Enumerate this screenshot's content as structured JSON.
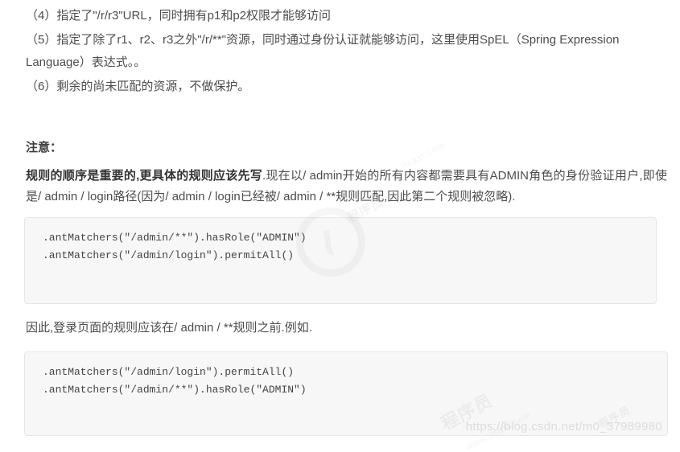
{
  "document": {
    "list_items": [
      {
        "id": "item-4",
        "text": "（4）指定了\"/r/r3\"URL，同时拥有p1和p2权限才能够访问"
      },
      {
        "id": "item-5",
        "text": "（5）指定了除了r1、r2、r3之外\"/r/**\"资源，同时通过身份认证就能够访问，这里使用SpEL（Spring Expression Language）表达式。。"
      },
      {
        "id": "item-6",
        "text": "（6）剩余的尚未匹配的资源，不做保护。"
      }
    ],
    "notice": {
      "title": "注意：",
      "bold_lead": "规则的顺序是重要的,更具体的规则应该先写",
      "rest": ".现在以/ admin开始的所有内容都需要具有ADMIN角色的身份验证用户,即使是/ admin / login路径(因为/ admin / login已经被/ admin / **规则匹配,因此第二个规则被忽略)."
    },
    "middle_text": "因此,登录页面的规则应该在/ admin / **规则之前.例如.",
    "code_blocks": [
      {
        "id": "code-block-1",
        "lines": [
          ".antMatchers(\"/admin/**\").hasRole(\"ADMIN\")",
          ".antMatchers(\"/admin/login\").permitAll()"
        ]
      },
      {
        "id": "code-block-2",
        "lines": [
          ".antMatchers(\"/admin/login\").permitAll()",
          ".antMatchers(\"/admin/**\").hasRole(\"ADMIN\")"
        ]
      }
    ],
    "watermarks": {
      "url": "https://blog.csdn.net/m0_37989980",
      "diagonal_1": "程序员",
      "diagonal_2": "www.itcast.com",
      "diagonal_3": "程序员",
      "diagonal_4": "www.itcast.com",
      "diagonal_5": "程序员"
    }
  },
  "colors": {
    "text": "#4d4d4d",
    "bold_text": "#333333",
    "code_bg": "#f7f7f7",
    "code_border": "#e6e6e6",
    "page_bg": "#ffffff"
  }
}
